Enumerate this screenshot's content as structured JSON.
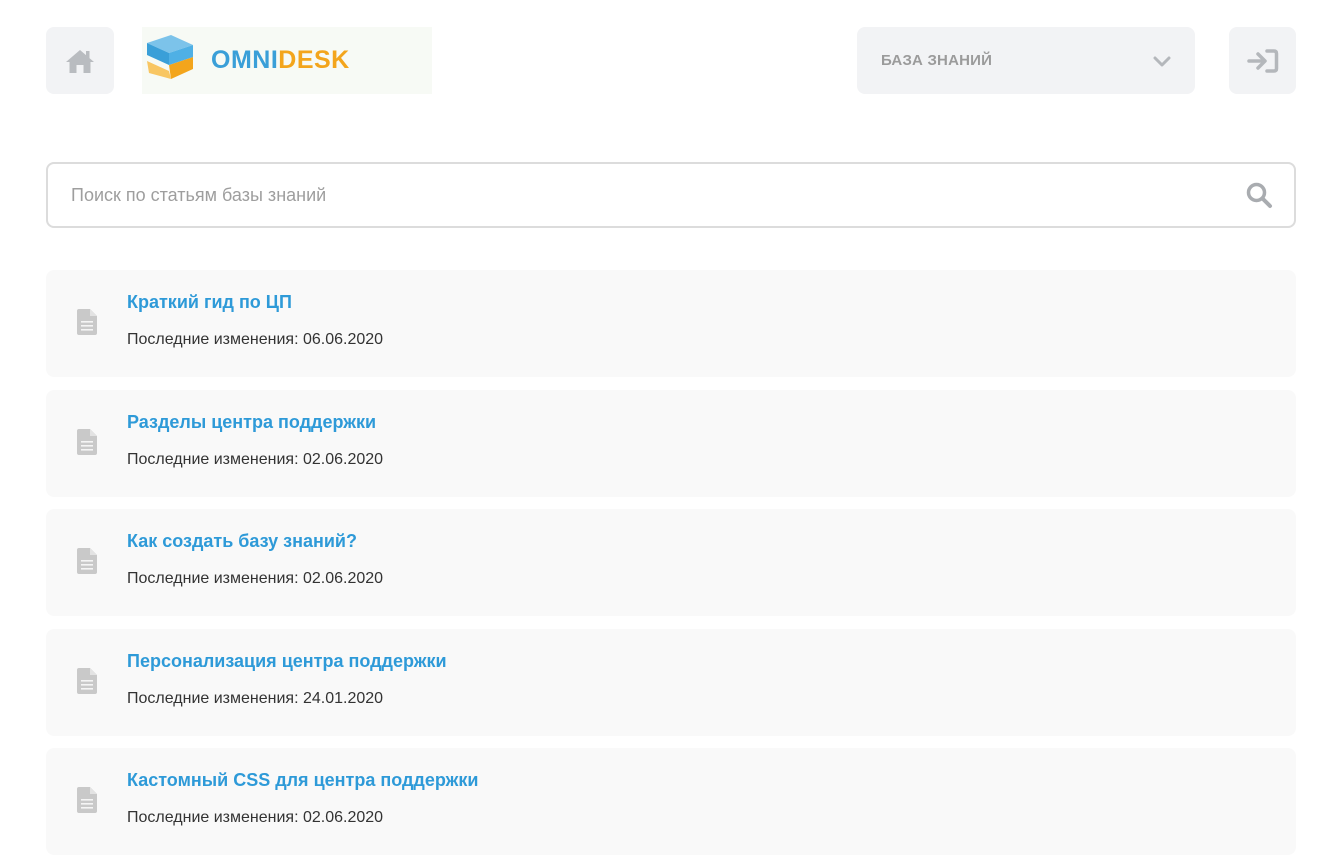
{
  "header": {
    "home_icon": "home-icon",
    "logo": {
      "text_part1": "OMNI",
      "text_part2": "DESK",
      "color1": "#3a9fd8",
      "color2": "#f3a51c"
    },
    "kb_select": {
      "label": "БАЗА ЗНАНИЙ",
      "icon": "chevron-down-icon"
    },
    "login_icon": "sign-in-icon"
  },
  "search": {
    "placeholder": "Поиск по статьям базы знаний",
    "value": "",
    "icon": "search-icon"
  },
  "articles": [
    {
      "title": "Краткий гид по ЦП",
      "date_text": "Последние изменения: 06.06.2020"
    },
    {
      "title": "Разделы центра поддержки",
      "date_text": "Последние изменения: 02.06.2020"
    },
    {
      "title": "Как создать базу знаний?",
      "date_text": "Последние изменения: 02.06.2020"
    },
    {
      "title": "Персонализация центра поддержки",
      "date_text": "Последние изменения: 24.01.2020"
    },
    {
      "title": "Кастомный CSS для центра поддержки",
      "date_text": "Последние изменения: 02.06.2020"
    }
  ],
  "colors": {
    "accent": "#2e9ad8",
    "panel": "#f2f3f5",
    "card": "#f9f9f9"
  }
}
